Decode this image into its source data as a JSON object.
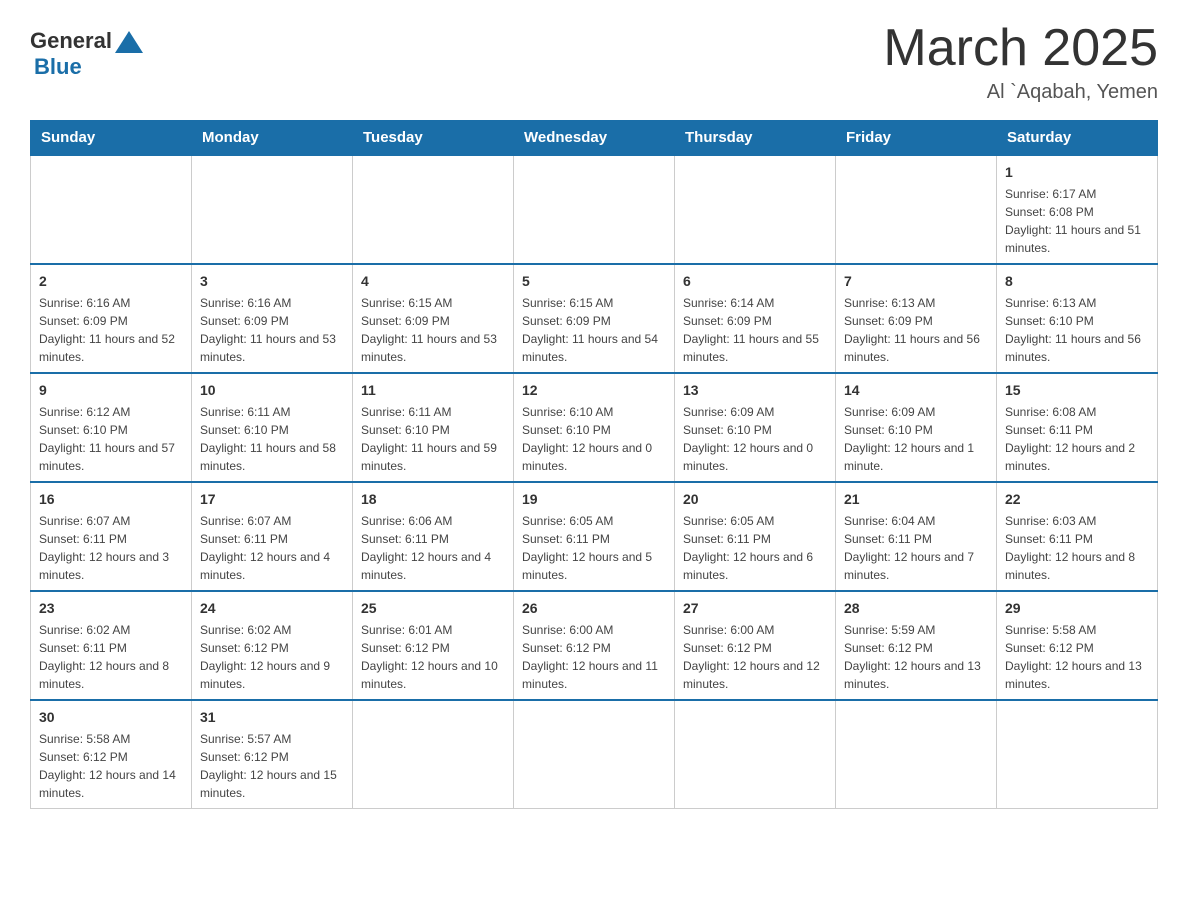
{
  "header": {
    "logo_general": "General",
    "logo_blue": "Blue",
    "title": "March 2025",
    "subtitle": "Al `Aqabah, Yemen"
  },
  "weekdays": [
    "Sunday",
    "Monday",
    "Tuesday",
    "Wednesday",
    "Thursday",
    "Friday",
    "Saturday"
  ],
  "weeks": [
    [
      {
        "day": "",
        "info": ""
      },
      {
        "day": "",
        "info": ""
      },
      {
        "day": "",
        "info": ""
      },
      {
        "day": "",
        "info": ""
      },
      {
        "day": "",
        "info": ""
      },
      {
        "day": "",
        "info": ""
      },
      {
        "day": "1",
        "info": "Sunrise: 6:17 AM\nSunset: 6:08 PM\nDaylight: 11 hours and 51 minutes."
      }
    ],
    [
      {
        "day": "2",
        "info": "Sunrise: 6:16 AM\nSunset: 6:09 PM\nDaylight: 11 hours and 52 minutes."
      },
      {
        "day": "3",
        "info": "Sunrise: 6:16 AM\nSunset: 6:09 PM\nDaylight: 11 hours and 53 minutes."
      },
      {
        "day": "4",
        "info": "Sunrise: 6:15 AM\nSunset: 6:09 PM\nDaylight: 11 hours and 53 minutes."
      },
      {
        "day": "5",
        "info": "Sunrise: 6:15 AM\nSunset: 6:09 PM\nDaylight: 11 hours and 54 minutes."
      },
      {
        "day": "6",
        "info": "Sunrise: 6:14 AM\nSunset: 6:09 PM\nDaylight: 11 hours and 55 minutes."
      },
      {
        "day": "7",
        "info": "Sunrise: 6:13 AM\nSunset: 6:09 PM\nDaylight: 11 hours and 56 minutes."
      },
      {
        "day": "8",
        "info": "Sunrise: 6:13 AM\nSunset: 6:10 PM\nDaylight: 11 hours and 56 minutes."
      }
    ],
    [
      {
        "day": "9",
        "info": "Sunrise: 6:12 AM\nSunset: 6:10 PM\nDaylight: 11 hours and 57 minutes."
      },
      {
        "day": "10",
        "info": "Sunrise: 6:11 AM\nSunset: 6:10 PM\nDaylight: 11 hours and 58 minutes."
      },
      {
        "day": "11",
        "info": "Sunrise: 6:11 AM\nSunset: 6:10 PM\nDaylight: 11 hours and 59 minutes."
      },
      {
        "day": "12",
        "info": "Sunrise: 6:10 AM\nSunset: 6:10 PM\nDaylight: 12 hours and 0 minutes."
      },
      {
        "day": "13",
        "info": "Sunrise: 6:09 AM\nSunset: 6:10 PM\nDaylight: 12 hours and 0 minutes."
      },
      {
        "day": "14",
        "info": "Sunrise: 6:09 AM\nSunset: 6:10 PM\nDaylight: 12 hours and 1 minute."
      },
      {
        "day": "15",
        "info": "Sunrise: 6:08 AM\nSunset: 6:11 PM\nDaylight: 12 hours and 2 minutes."
      }
    ],
    [
      {
        "day": "16",
        "info": "Sunrise: 6:07 AM\nSunset: 6:11 PM\nDaylight: 12 hours and 3 minutes."
      },
      {
        "day": "17",
        "info": "Sunrise: 6:07 AM\nSunset: 6:11 PM\nDaylight: 12 hours and 4 minutes."
      },
      {
        "day": "18",
        "info": "Sunrise: 6:06 AM\nSunset: 6:11 PM\nDaylight: 12 hours and 4 minutes."
      },
      {
        "day": "19",
        "info": "Sunrise: 6:05 AM\nSunset: 6:11 PM\nDaylight: 12 hours and 5 minutes."
      },
      {
        "day": "20",
        "info": "Sunrise: 6:05 AM\nSunset: 6:11 PM\nDaylight: 12 hours and 6 minutes."
      },
      {
        "day": "21",
        "info": "Sunrise: 6:04 AM\nSunset: 6:11 PM\nDaylight: 12 hours and 7 minutes."
      },
      {
        "day": "22",
        "info": "Sunrise: 6:03 AM\nSunset: 6:11 PM\nDaylight: 12 hours and 8 minutes."
      }
    ],
    [
      {
        "day": "23",
        "info": "Sunrise: 6:02 AM\nSunset: 6:11 PM\nDaylight: 12 hours and 8 minutes."
      },
      {
        "day": "24",
        "info": "Sunrise: 6:02 AM\nSunset: 6:12 PM\nDaylight: 12 hours and 9 minutes."
      },
      {
        "day": "25",
        "info": "Sunrise: 6:01 AM\nSunset: 6:12 PM\nDaylight: 12 hours and 10 minutes."
      },
      {
        "day": "26",
        "info": "Sunrise: 6:00 AM\nSunset: 6:12 PM\nDaylight: 12 hours and 11 minutes."
      },
      {
        "day": "27",
        "info": "Sunrise: 6:00 AM\nSunset: 6:12 PM\nDaylight: 12 hours and 12 minutes."
      },
      {
        "day": "28",
        "info": "Sunrise: 5:59 AM\nSunset: 6:12 PM\nDaylight: 12 hours and 13 minutes."
      },
      {
        "day": "29",
        "info": "Sunrise: 5:58 AM\nSunset: 6:12 PM\nDaylight: 12 hours and 13 minutes."
      }
    ],
    [
      {
        "day": "30",
        "info": "Sunrise: 5:58 AM\nSunset: 6:12 PM\nDaylight: 12 hours and 14 minutes."
      },
      {
        "day": "31",
        "info": "Sunrise: 5:57 AM\nSunset: 6:12 PM\nDaylight: 12 hours and 15 minutes."
      },
      {
        "day": "",
        "info": ""
      },
      {
        "day": "",
        "info": ""
      },
      {
        "day": "",
        "info": ""
      },
      {
        "day": "",
        "info": ""
      },
      {
        "day": "",
        "info": ""
      }
    ]
  ]
}
